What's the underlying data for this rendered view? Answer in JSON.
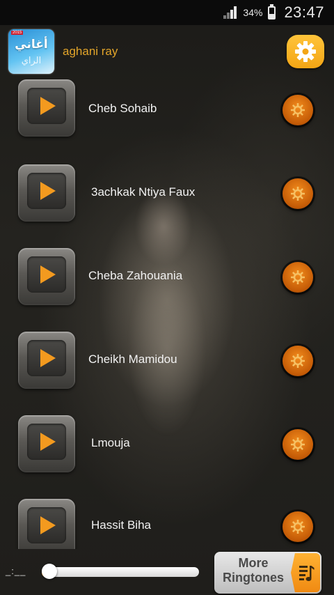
{
  "status_bar": {
    "battery_percent": "34%",
    "time": "23:47",
    "icons": [
      "signal-icon",
      "battery-icon"
    ]
  },
  "header": {
    "logo_text_main": "أغاني",
    "logo_text_sub": "الراي",
    "logo_badge": "2015",
    "title": "aghani ray",
    "settings_icon": "gear-icon"
  },
  "songs": [
    {
      "title": "Cheb Sohaib"
    },
    {
      "title": "3achkak Ntiya Faux"
    },
    {
      "title": "Cheba Zahouania"
    },
    {
      "title": "Cheikh Mamidou"
    },
    {
      "title": "Lmouja"
    },
    {
      "title": "Hassit Biha"
    }
  ],
  "player": {
    "time_display": "_:__",
    "progress": 0.05
  },
  "more_button": {
    "line1": "More",
    "line2": "Ringtones",
    "icon": "music-list-icon"
  },
  "colors": {
    "accent": "#f39a1f",
    "title": "#e3a52a",
    "settings_bg": "#ffc43a"
  }
}
